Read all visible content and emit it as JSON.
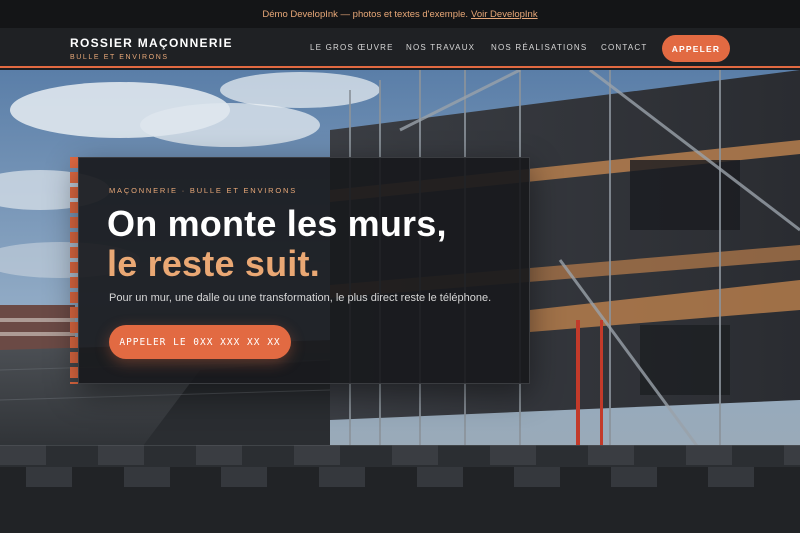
{
  "demo_notice": {
    "text": "Démo DevelopInk — photos et textes d'exemple.",
    "link_label": "Voir DevelopInk"
  },
  "header": {
    "brand_name": "ROSSIER MAÇONNERIE",
    "brand_tagline": "BULLE ET ENVIRONS",
    "nav": [
      {
        "label": "LE GROS ŒUVRE"
      },
      {
        "label": "NOS TRAVAUX"
      },
      {
        "label": "NOS RÉALISATIONS"
      },
      {
        "label": "CONTACT"
      }
    ],
    "cta_label": "APPELER"
  },
  "hero": {
    "eyebrow": "MAÇONNERIE · BULLE ET ENVIRONS",
    "headline_line1": "On monte les murs,",
    "headline_line2": "le reste suit.",
    "lead": "Pour un mur, une dalle ou une transformation, le plus direct reste le téléphone.",
    "cta_label": "APPELER LE 0XX XXX XX XX",
    "background_image": "construction-site-scaffolding-photo"
  },
  "colors": {
    "accent": "#e26a42",
    "accent_light": "#eaa874",
    "header_bg": "#1f2124",
    "card_bg": "#18191c",
    "band_bg": "#212326"
  }
}
